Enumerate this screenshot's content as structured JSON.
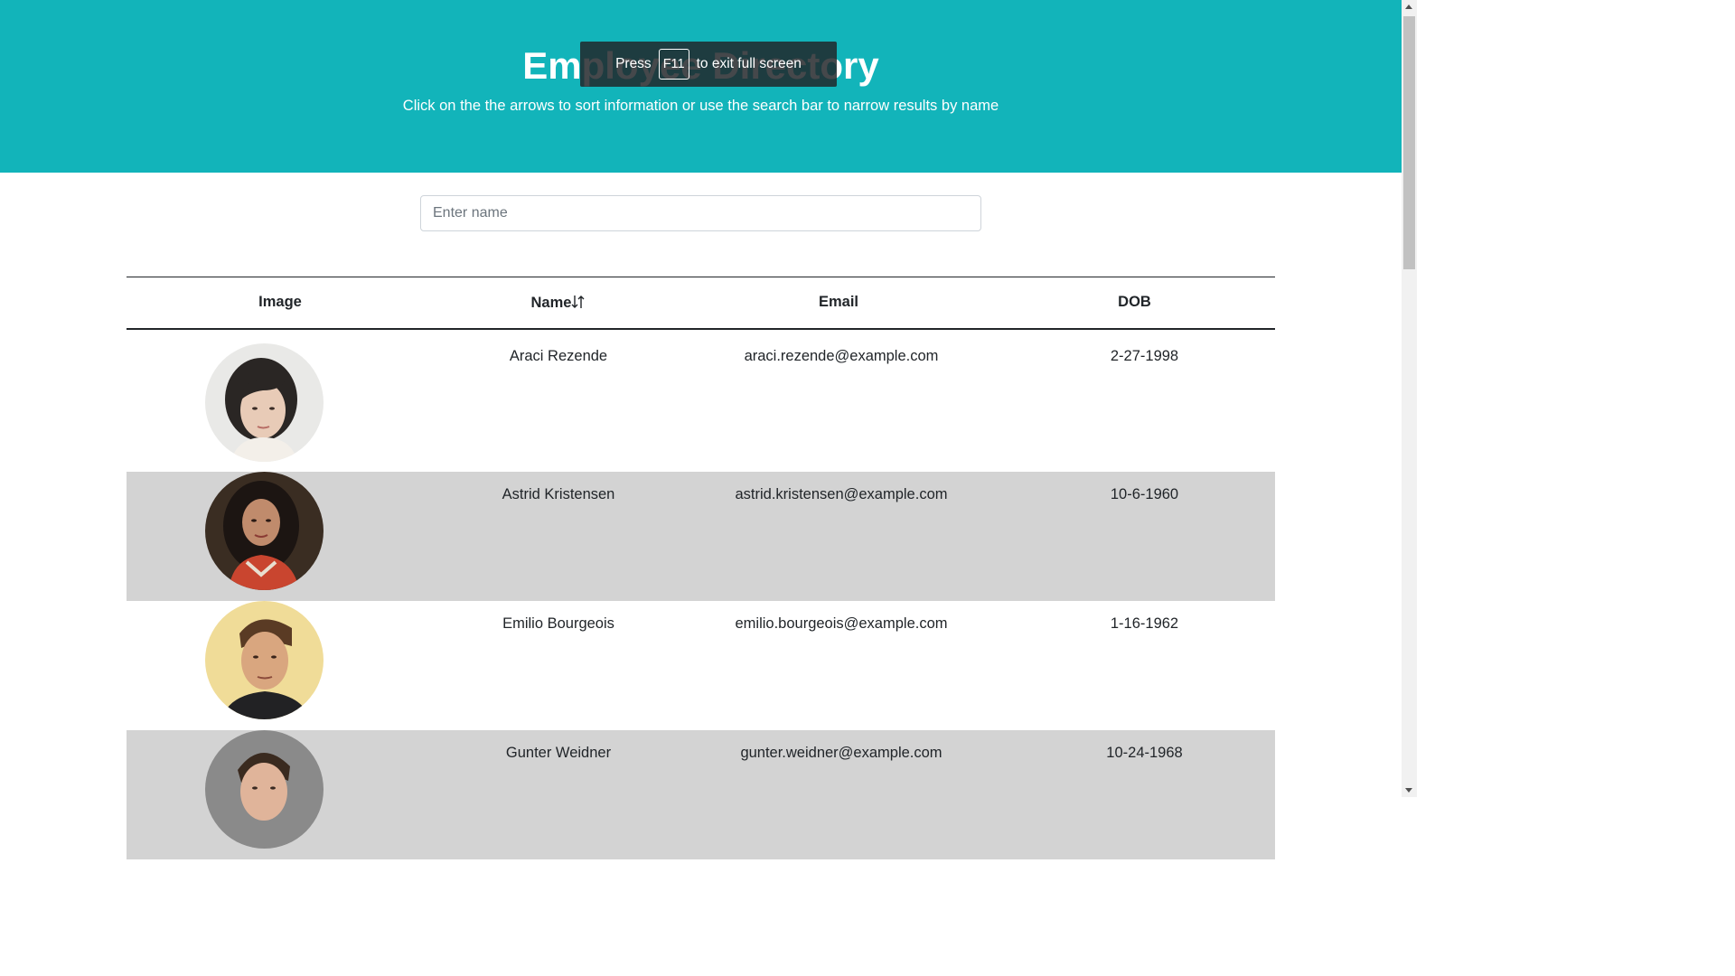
{
  "header": {
    "title": "Employee Directory",
    "subtitle": "Click on the the arrows to sort information or use the search bar to narrow results by name"
  },
  "fullscreen_notice": {
    "prefix": "Press",
    "key": "F11",
    "suffix": "to exit full screen"
  },
  "search": {
    "placeholder": "Enter name",
    "value": ""
  },
  "table": {
    "columns": {
      "image": "Image",
      "name": "Name",
      "email": "Email",
      "dob": "DOB"
    },
    "sort_icon": "sort-arrows-icon",
    "rows": [
      {
        "name": "Araci Rezende",
        "email": "araci.rezende@example.com",
        "dob": "2-27-1998",
        "photo": "avatar-woman-short-hair"
      },
      {
        "name": "Astrid Kristensen",
        "email": "astrid.kristensen@example.com",
        "dob": "10-6-1960",
        "photo": "avatar-woman-long-hair"
      },
      {
        "name": "Emilio Bourgeois",
        "email": "emilio.bourgeois@example.com",
        "dob": "1-16-1962",
        "photo": "avatar-man-dark-shirt"
      },
      {
        "name": "Gunter Weidner",
        "email": "gunter.weidner@example.com",
        "dob": "10-24-1968",
        "photo": "avatar-man-short-hair"
      }
    ]
  },
  "colors": {
    "hero_background": "#12b4ba",
    "stripe_background": "#d3d3d3",
    "text": "#212529"
  }
}
